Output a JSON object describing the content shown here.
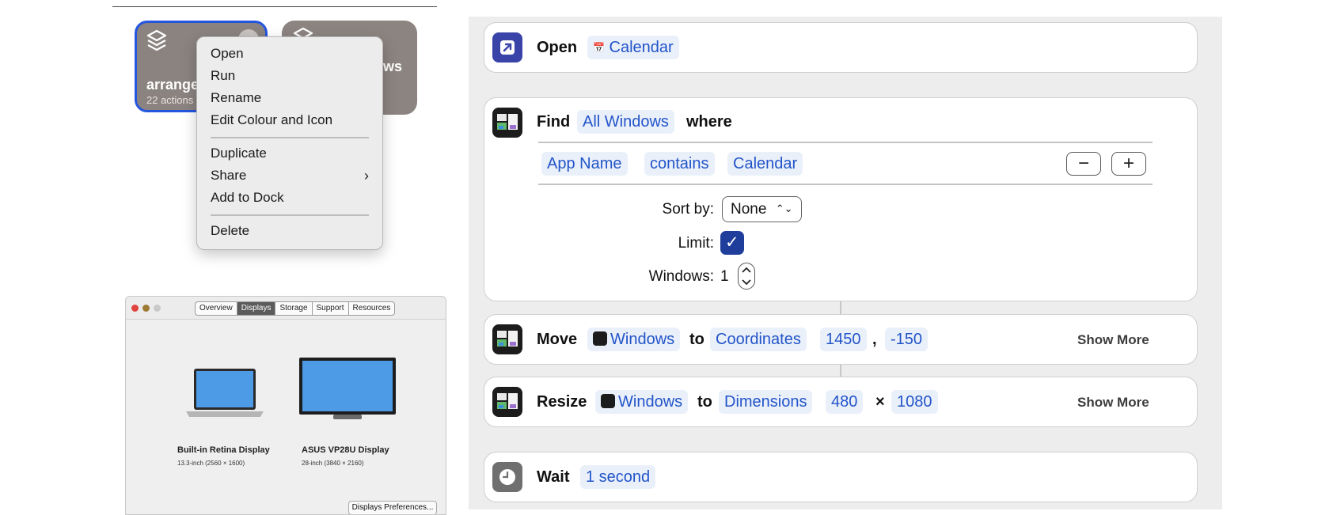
{
  "shortcut_tiles": {
    "tile_a": {
      "title": "arrange",
      "subtitle": "22 actions"
    },
    "tile_b": {
      "title_fragment": "ws"
    }
  },
  "context_menu": {
    "items": [
      "Open",
      "Run",
      "Rename",
      "Edit Colour and Icon",
      "Duplicate",
      "Share",
      "Add to Dock",
      "Delete"
    ],
    "share_chevron": "›"
  },
  "about_mac": {
    "tabs": [
      "Overview",
      "Displays",
      "Storage",
      "Support",
      "Resources"
    ],
    "active_tab": "Displays",
    "displays": [
      {
        "name": "Built-in Retina Display",
        "spec": "13.3-inch (2560 × 1600)"
      },
      {
        "name": "ASUS VP28U Display",
        "spec": "28-inch (3840 × 2160)"
      }
    ],
    "prefs_button": "Displays Preferences..."
  },
  "editor": {
    "open_action": {
      "verb": "Open",
      "app_icon": "📅",
      "app": "Calendar"
    },
    "find_action": {
      "verb": "Find",
      "subject": "All Windows",
      "where": "where",
      "filter": {
        "field": "App Name",
        "operator": "contains",
        "value": "Calendar"
      },
      "minus": "−",
      "plus": "+",
      "sort_label": "Sort by:",
      "sort_value": "None",
      "sort_arrows": "⌃⌄",
      "limit_label": "Limit:",
      "limit_checked": "✓",
      "windows_label": "Windows:",
      "windows_value": "1"
    },
    "move_action": {
      "verb": "Move",
      "subject": "Windows",
      "to": "to",
      "target": "Coordinates",
      "x": "1450",
      "comma": ",",
      "y": "-150",
      "show_more": "Show More"
    },
    "resize_action": {
      "verb": "Resize",
      "subject": "Windows",
      "to": "to",
      "target": "Dimensions",
      "width": "480",
      "times": "×",
      "height": "1080",
      "show_more": "Show More"
    },
    "wait_action": {
      "verb": "Wait",
      "duration": "1 second"
    }
  }
}
